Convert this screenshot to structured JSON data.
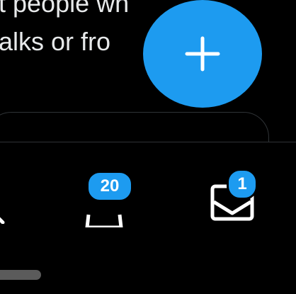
{
  "tweet": {
    "line1": "t people wh",
    "line2": "alks or fro"
  },
  "compose": {
    "icon": "plus-icon",
    "color": "#1d9bf0"
  },
  "tabbar": {
    "notifications": {
      "icon": "bell-icon",
      "badge": "20"
    },
    "messages": {
      "icon": "envelope-icon",
      "badge": "1"
    },
    "search": {
      "icon": "search-icon"
    }
  },
  "colors": {
    "background": "#000000",
    "accent": "#1d9bf0",
    "text": "#e7e9ea",
    "divider": "#2f3336"
  }
}
